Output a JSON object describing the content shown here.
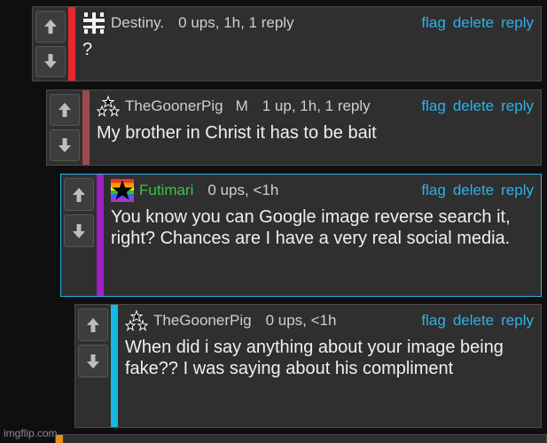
{
  "comments": [
    {
      "username": "Destiny.",
      "mod": "",
      "meta": "0 ups, 1h, 1 reply",
      "text": "?",
      "bar_color": "#e8282e",
      "avatar": "glyph-avatar-icon"
    },
    {
      "username": "TheGoonerPig",
      "mod": "M",
      "meta": "1 up, 1h, 1 reply",
      "text": "My brother in Christ it has to be bait",
      "bar_color": "#9a4a4a",
      "avatar": "three-stars-avatar-icon"
    },
    {
      "username": "Futimari",
      "mod": "",
      "meta": "0 ups, <1h",
      "text": "You know you can Google image reverse search it, right? Chances are I have a very real social media.",
      "bar_color": "#a01ec4",
      "avatar": "rainbow-star-avatar-icon"
    },
    {
      "username": "TheGoonerPig",
      "mod": "",
      "meta": "0 ups, <1h",
      "text": "When did i say anything about your image being fake?? I was saying about his compliment",
      "bar_color": "#19b7e6",
      "avatar": "three-stars-avatar-icon"
    }
  ],
  "actions": {
    "flag": "flag",
    "delete": "delete",
    "reply": "reply"
  },
  "partial_bar_color": "#e8901a",
  "watermark": "imgflip.com"
}
